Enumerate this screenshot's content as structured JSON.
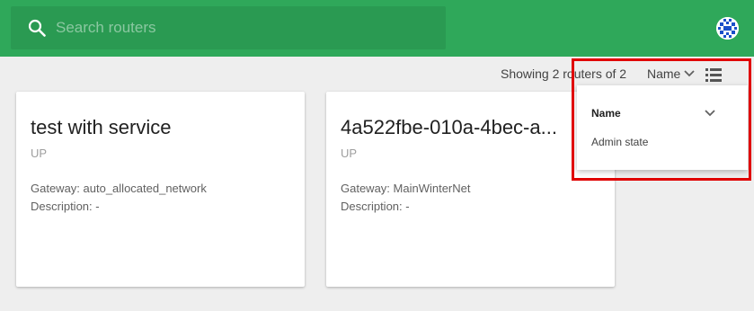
{
  "search": {
    "placeholder": "Search routers"
  },
  "toolbar": {
    "showing_text": "Showing 2 routers of 2",
    "sort_label": "Name"
  },
  "cards": [
    {
      "title": "test with service",
      "status": "UP",
      "gateway": "Gateway: auto_allocated_network",
      "description": "Description: -"
    },
    {
      "title": "4a522fbe-010a-4bec-a...",
      "status": "UP",
      "gateway": "Gateway: MainWinterNet",
      "description": "Description: -"
    }
  ],
  "sort_menu": {
    "options": [
      "Name",
      "Admin state"
    ]
  },
  "colors": {
    "header": "#2fa85a",
    "search_bg": "#2a9a52",
    "highlight": "#e00000"
  }
}
